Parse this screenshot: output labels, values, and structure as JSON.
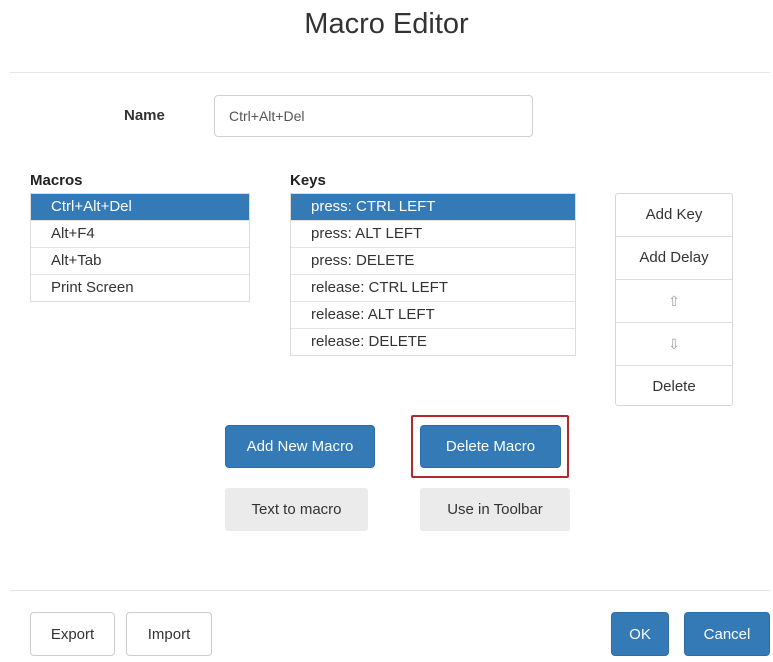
{
  "dialog": {
    "title": "Macro Editor",
    "name_label": "Name",
    "name_value": "Ctrl+Alt+Del"
  },
  "macros": {
    "title": "Macros",
    "items": [
      "Ctrl+Alt+Del",
      "Alt+F4",
      "Alt+Tab",
      "Print Screen"
    ],
    "selected": "Ctrl+Alt+Del"
  },
  "keys": {
    "title": "Keys",
    "items": [
      "press: CTRL LEFT",
      "press: ALT LEFT",
      "press: DELETE",
      "release: CTRL LEFT",
      "release: ALT LEFT",
      "release: DELETE"
    ],
    "selected": "press: CTRL LEFT"
  },
  "key_actions": {
    "add_key": "Add Key",
    "add_delay": "Add Delay",
    "move_up_icon": "⇧",
    "move_down_icon": "⇩",
    "delete": "Delete"
  },
  "macro_actions": {
    "add_new_macro": "Add New Macro",
    "delete_macro": "Delete Macro",
    "text_to_macro": "Text to macro",
    "use_in_toolbar": "Use in Toolbar"
  },
  "footer": {
    "export": "Export",
    "import": "Import",
    "ok": "OK",
    "cancel": "Cancel"
  },
  "colors": {
    "primary": "#337ab7",
    "highlight": "#b3272d"
  }
}
